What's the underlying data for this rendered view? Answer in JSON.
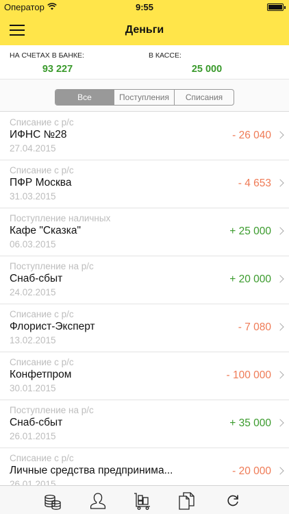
{
  "status": {
    "carrier": "Оператор",
    "time": "9:55"
  },
  "header": {
    "title": "Деньги"
  },
  "balances": {
    "bank_label": "НА СЧЕТАХ В БАНКЕ:",
    "bank_value": "93 227",
    "cash_label": "В КАССЕ:",
    "cash_value": "25 000"
  },
  "filter": {
    "tabs": [
      "Все",
      "Поступления",
      "Списания"
    ],
    "selected": "Все"
  },
  "transactions": [
    {
      "type": "Списание с р/с",
      "name": "ИФНС №28",
      "date": "27.04.2015",
      "amount": "- 26 040"
    },
    {
      "type": "Списание с р/с",
      "name": "ПФР Москва",
      "date": "31.03.2015",
      "amount": "- 4 653"
    },
    {
      "type": "Поступление наличных",
      "name": "Кафе \"Сказка\"",
      "date": "06.03.2015",
      "amount": "+ 25 000"
    },
    {
      "type": "Поступление на р/с",
      "name": "Снаб-сбыт",
      "date": "24.02.2015",
      "amount": "+ 20 000"
    },
    {
      "type": "Списание с р/с",
      "name": "Флорист-Эксперт",
      "date": "13.02.2015",
      "amount": "- 7 080"
    },
    {
      "type": "Списание с р/с",
      "name": "Конфетпром",
      "date": "30.01.2015",
      "amount": "- 100 000"
    },
    {
      "type": "Поступление на р/с",
      "name": "Снаб-сбыт",
      "date": "26.01.2015",
      "amount": "+ 35 000"
    },
    {
      "type": "Списание с р/с",
      "name": "Личные средства предпринима...",
      "date": "26.01.2015",
      "amount": "- 20 000"
    }
  ],
  "colors": {
    "brand_yellow": "#ffe54a",
    "positive": "#3a9a2c",
    "negative": "#ef7a55"
  },
  "tabbar": {
    "icons": [
      "coins-icon",
      "person-icon",
      "warehouse-cart-icon",
      "documents-icon",
      "refresh-icon"
    ]
  }
}
